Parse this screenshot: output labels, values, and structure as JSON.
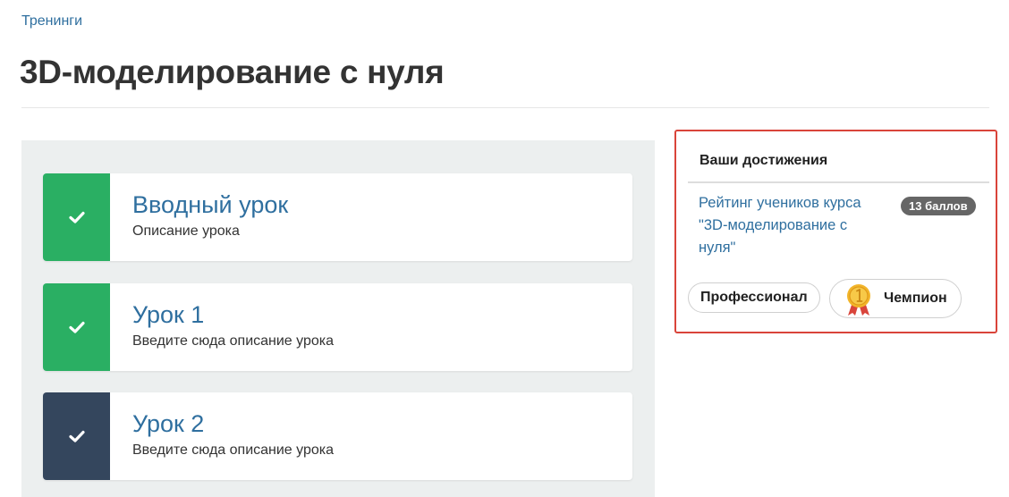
{
  "breadcrumb": {
    "label": "Тренинги"
  },
  "page": {
    "title": "3D-моделирование с нуля"
  },
  "lessons": [
    {
      "title": "Вводный урок",
      "description": "Описание урока",
      "status": "completed"
    },
    {
      "title": "Урок 1",
      "description": "Введите сюда описание урока",
      "status": "completed"
    },
    {
      "title": "Урок 2",
      "description": "Введите сюда описание урока",
      "status": "current"
    }
  ],
  "achievements": {
    "header": "Ваши достижения",
    "rating_link": "Рейтинг учеников курса \"3D-моделирование с нуля\"",
    "points": "13 баллов",
    "badges": [
      {
        "label": "Профессионал"
      },
      {
        "label": "Чемпион",
        "icon": "gold-medal-icon"
      }
    ]
  },
  "colors": {
    "link": "#2f6f9f",
    "completed": "#2aaf63",
    "current": "#34465d",
    "highlight_border": "#d9443a",
    "points_badge": "#666666",
    "panel_bg": "#ecefef"
  }
}
